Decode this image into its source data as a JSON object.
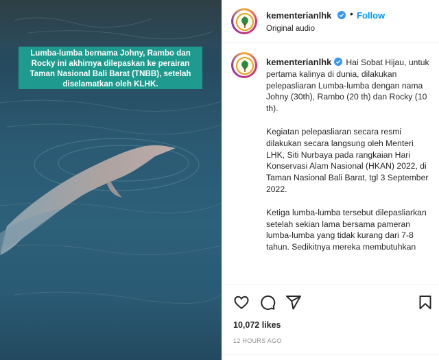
{
  "media": {
    "caption": "Lumba-lumba bernama Johny, Rambo dan Rocky ini akhirnya dilepaskan ke perairan Taman Nasional Bali Barat (TNBB), setelah diselamatkan oleh KLHK."
  },
  "header": {
    "username": "kementerianlhk",
    "separator": "•",
    "follow_label": "Follow",
    "audio_label": "Original audio",
    "more_label": "···"
  },
  "caption_post": {
    "username": "kementerianlhk",
    "paragraphs": [
      "Hai Sobat Hijau, untuk pertama kalinya di dunia, dilakukan pelepasliaran Lumba-lumba dengan nama Johny (30th), Rambo (20 th) dan Rocky (10 th).",
      "Kegiatan pelepasliaran secara resmi dilakukan secara langsung oleh Menteri LHK, Siti Nurbaya pada rangkaian Hari Konservasi Alam Nasional (HKAN) 2022, di Taman Nasional Bali Barat, tgl 3 September 2022.",
      "Ketiga lumba-lumba tersebut dilepasliarkan setelah sekian lama bersama pameran lumba-lumba yang tidak kurang dari 7-8 tahun. Sedikitnya mereka membutuhkan"
    ]
  },
  "actions": {
    "like_icon": "heart-icon",
    "comment_icon": "comment-icon",
    "share_icon": "share-icon",
    "save_icon": "bookmark-icon"
  },
  "stats": {
    "likes": "10,072 likes",
    "timestamp": "12 HOURS AGO"
  },
  "colors": {
    "accent": "#0095f6",
    "verified": "#3897f0",
    "caption_bg": "#1f9a8e"
  }
}
